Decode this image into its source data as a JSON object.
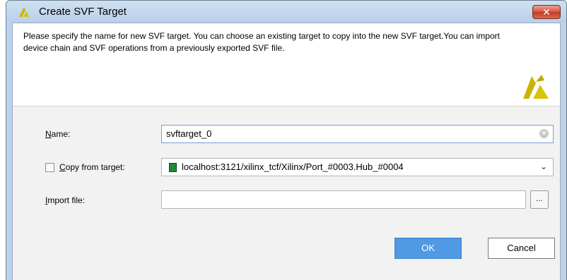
{
  "window": {
    "title": "Create SVF Target",
    "close_label": "✕"
  },
  "header": {
    "description": "Please specify the name for new SVF target. You can choose an existing target to copy into the new SVF target.You can import device chain and SVF operations from a previously exported SVF file."
  },
  "form": {
    "name": {
      "label_underlined": "N",
      "label_rest": "ame:",
      "value": "svftarget_0"
    },
    "copy_from_target": {
      "label_underlined": "C",
      "label_rest": "opy from target:",
      "checked": false,
      "selected_value": "localhost:3121/xilinx_tcf/Xilinx/Port_#0003.Hub_#0004"
    },
    "import_file": {
      "label_underlined": "I",
      "label_rest": "mport file:",
      "value": "",
      "browse_label": "..."
    }
  },
  "buttons": {
    "ok": "OK",
    "cancel": "Cancel"
  },
  "colors": {
    "accent": "#4f9ae3",
    "xilinx_logo": "#c8b400",
    "title_bar": "#bcd3ec"
  }
}
